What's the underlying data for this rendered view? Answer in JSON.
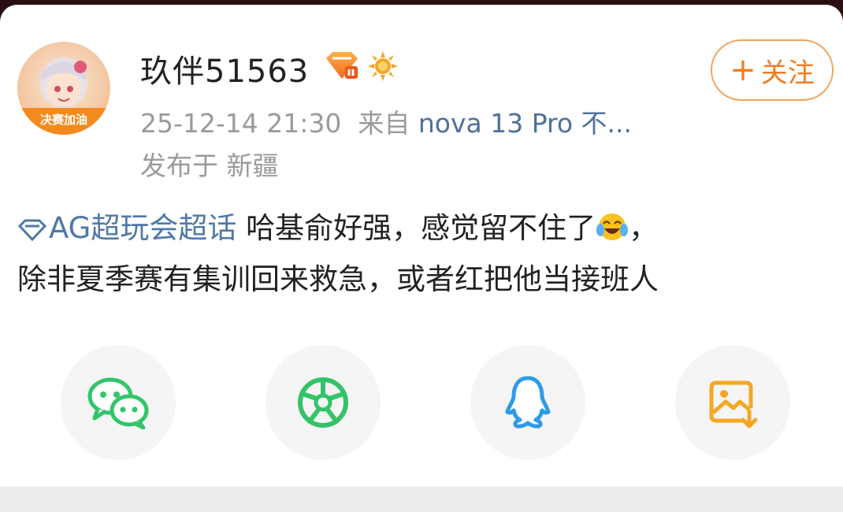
{
  "post": {
    "username": "玖伴51563",
    "timestamp": "25-12-14 21:30",
    "source_prefix": "来自",
    "source_device": "nova 13 Pro 不...",
    "location": "发布于 新疆",
    "follow_label": "关注",
    "follow_plus": "+",
    "avatar_text": "决赛加油",
    "topic": "AG超玩会超话",
    "text_line1": "哈基俞好强，感觉留不住了",
    "text_comma": "，",
    "text_line2": "除非夏季赛有集训回来救急，或者红把他当接班人"
  },
  "share": {
    "items": [
      {
        "name": "wechat",
        "icon": "wechat-icon",
        "color": "#34c46a"
      },
      {
        "name": "moments",
        "icon": "moments-icon",
        "color": "#35c36a"
      },
      {
        "name": "qq",
        "icon": "qq-icon",
        "color": "#2d9be8"
      },
      {
        "name": "save-image",
        "icon": "save-image-icon",
        "color": "#f5a623"
      }
    ]
  },
  "colors": {
    "accent": "#f07e1f",
    "link": "#4f78a8",
    "meta": "#9a9a9a"
  }
}
